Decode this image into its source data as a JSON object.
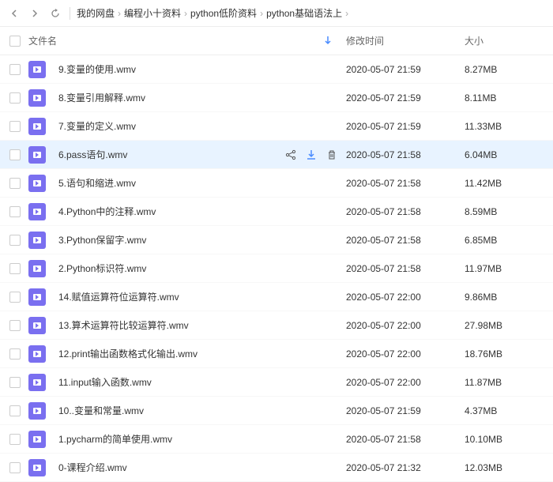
{
  "breadcrumb": {
    "items": [
      "我的网盘",
      "编程小十资料",
      "python低阶资料",
      "python基础语法上"
    ]
  },
  "columns": {
    "name": "文件名",
    "time": "修改时间",
    "size": "大小"
  },
  "hovered_index": 3,
  "files": [
    {
      "name": "9.变量的使用.wmv",
      "time": "2020-05-07 21:59",
      "size": "8.27MB"
    },
    {
      "name": "8.变量引用解释.wmv",
      "time": "2020-05-07 21:59",
      "size": "8.11MB"
    },
    {
      "name": "7.变量的定义.wmv",
      "time": "2020-05-07 21:59",
      "size": "11.33MB"
    },
    {
      "name": "6.pass语句.wmv",
      "time": "2020-05-07 21:58",
      "size": "6.04MB"
    },
    {
      "name": "5.语句和缩进.wmv",
      "time": "2020-05-07 21:58",
      "size": "11.42MB"
    },
    {
      "name": "4.Python中的注释.wmv",
      "time": "2020-05-07 21:58",
      "size": "8.59MB"
    },
    {
      "name": "3.Python保留字.wmv",
      "time": "2020-05-07 21:58",
      "size": "6.85MB"
    },
    {
      "name": "2.Python标识符.wmv",
      "time": "2020-05-07 21:58",
      "size": "11.97MB"
    },
    {
      "name": "14.赋值运算符位运算符.wmv",
      "time": "2020-05-07 22:00",
      "size": "9.86MB"
    },
    {
      "name": "13.算术运算符比较运算符.wmv",
      "time": "2020-05-07 22:00",
      "size": "27.98MB"
    },
    {
      "name": "12.print输出函数格式化输出.wmv",
      "time": "2020-05-07 22:00",
      "size": "18.76MB"
    },
    {
      "name": "11.input输入函数.wmv",
      "time": "2020-05-07 22:00",
      "size": "11.87MB"
    },
    {
      "name": "10..变量和常量.wmv",
      "time": "2020-05-07 21:59",
      "size": "4.37MB"
    },
    {
      "name": "1.pycharm的简单使用.wmv",
      "time": "2020-05-07 21:58",
      "size": "10.10MB"
    },
    {
      "name": "0-课程介绍.wmv",
      "time": "2020-05-07 21:32",
      "size": "12.03MB"
    }
  ]
}
